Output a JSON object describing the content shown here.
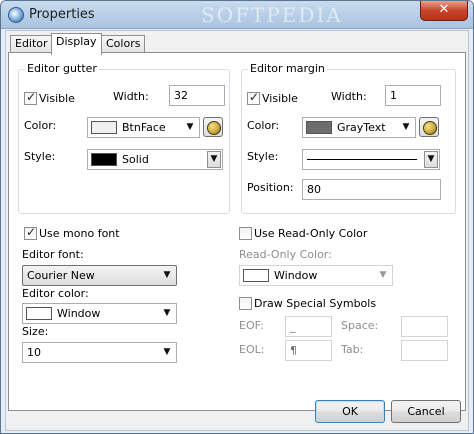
{
  "window": {
    "title": "Properties",
    "close_glyph": "✕",
    "watermark": "SOFTPEDIA",
    "icon": "properties-app-icon"
  },
  "tabs": [
    {
      "label": "Editor",
      "active": false
    },
    {
      "label": "Display",
      "active": true
    },
    {
      "label": "Colors",
      "active": false
    }
  ],
  "gutter": {
    "title": "Editor gutter",
    "visible_label": "Visible",
    "visible_checked": true,
    "width_label": "Width:",
    "width_value": "32",
    "color_label": "Color:",
    "color_value": "BtnFace",
    "color_swatch": "#f0f0f0",
    "style_label": "Style:",
    "style_value": "Solid",
    "style_swatch": "#000000"
  },
  "margin": {
    "title": "Editor margin",
    "visible_label": "Visible",
    "visible_checked": true,
    "width_label": "Width:",
    "width_value": "1",
    "color_label": "Color:",
    "color_value": "GrayText",
    "color_swatch": "#6d6d6d",
    "style_label": "Style:",
    "position_label": "Position:",
    "position_value": "80"
  },
  "font": {
    "mono_label": "Use mono font",
    "mono_checked": true,
    "editor_font_label": "Editor font:",
    "editor_font_value": "Courier New",
    "editor_color_label": "Editor color:",
    "editor_color_value": "Window",
    "editor_color_swatch": "#ffffff",
    "size_label": "Size:",
    "size_value": "10"
  },
  "readonly": {
    "use_label": "Use Read-Only Color",
    "use_checked": false,
    "color_label": "Read-Only Color:",
    "color_value": "Window",
    "color_swatch": "#ffffff"
  },
  "symbols": {
    "draw_label": "Draw Special Symbols",
    "draw_checked": false,
    "eof_label": "EOF:",
    "eof_value": "_",
    "space_label": "Space:",
    "space_value": "",
    "eol_label": "EOL:",
    "eol_value": "¶",
    "tab_label": "Tab:",
    "tab_value": ""
  },
  "buttons": {
    "ok_label": "OK",
    "cancel_label": "Cancel"
  }
}
